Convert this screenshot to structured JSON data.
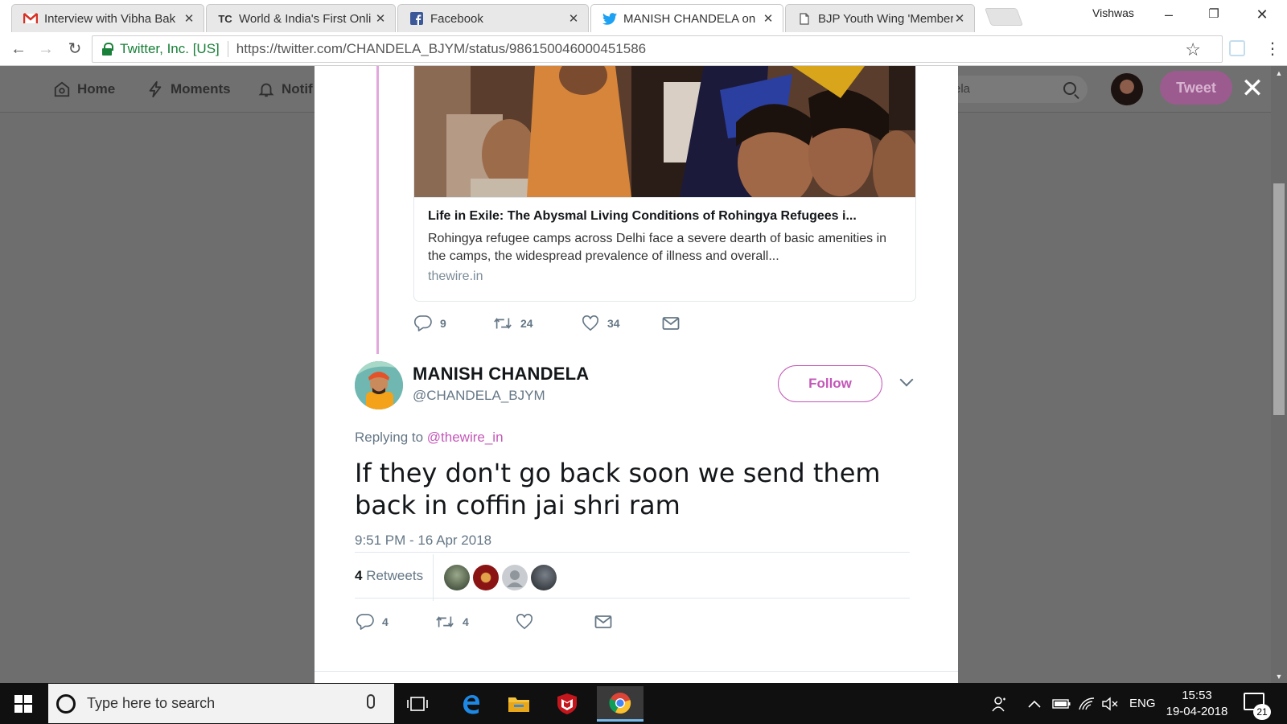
{
  "browser": {
    "tabs": [
      {
        "title": "Interview with Vibha Bak",
        "favicon": "gmail-icon",
        "active": false
      },
      {
        "title": "World & India's First Onli",
        "favicon": "techcrunch-icon",
        "favicon_text": "TC",
        "active": false
      },
      {
        "title": "Facebook",
        "favicon": "facebook-icon",
        "active": false
      },
      {
        "title": "MANISH CHANDELA on",
        "favicon": "twitter-icon",
        "active": true
      },
      {
        "title": "BJP Youth Wing 'Member",
        "favicon": "page-icon",
        "active": false
      }
    ],
    "profile_name": "Vishwas",
    "site_identity": "Twitter, Inc. [US]",
    "url": "https://twitter.com/CHANDELA_BJYM/status/986150046000451586"
  },
  "twitter_nav": {
    "home": "Home",
    "moments": "Moments",
    "notifications": "Notif",
    "search_value": "ela",
    "tweet_button": "Tweet"
  },
  "quoted_card": {
    "title": "Life in Exile: The Abysmal Living Conditions of Rohingya Refugees i...",
    "description": "Rohingya refugee camps across Delhi face a severe dearth of basic amenities in the camps, the widespread prevalence of illness and overall...",
    "domain": "thewire.in"
  },
  "parent_actions": {
    "replies": "9",
    "retweets": "24",
    "likes": "34"
  },
  "tweet": {
    "author_name": "MANISH CHANDELA",
    "author_handle": "@CHANDELA_BJYM",
    "follow_label": "Follow",
    "replying_prefix": "Replying to",
    "replying_to": "@thewire_in",
    "text": "If they don't go back soon we send them back in coffin jai shri ram",
    "timestamp": "9:51 PM - 16 Apr 2018",
    "retweet_count": "4",
    "retweet_label": "Retweets",
    "replies": "4",
    "retweets": "4",
    "likes": ""
  },
  "colors": {
    "accent": "#c458b8",
    "thread_line": "#e2a7dc",
    "muted": "#657786"
  },
  "taskbar": {
    "search_placeholder": "Type here to search",
    "language": "ENG",
    "time": "15:53",
    "date": "19-04-2018",
    "notification_count": "21"
  }
}
